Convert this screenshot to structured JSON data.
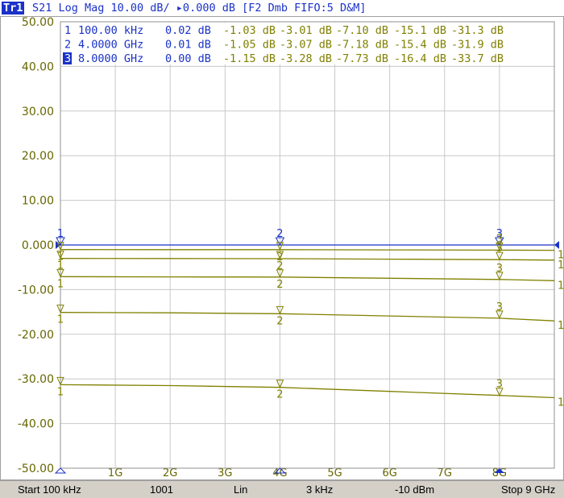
{
  "header": {
    "trace": "Tr1",
    "info": "S21 Log Mag 10.00 dB/ ▸0.000 dB [F2 Dmb FIFO:5 D&M]"
  },
  "footer": {
    "start": "Start 100 kHz",
    "points": "1001",
    "sweep_type": "Lin",
    "ifbw": "3 kHz",
    "power": "-10 dBm",
    "stop": "Stop 9 GHz"
  },
  "colors": {
    "active": "#1a32c8",
    "trace": "#808000",
    "grid": "#c8c8c8",
    "axis_text": "#666600"
  },
  "chart_data": {
    "type": "line",
    "title": "",
    "xlabel": "",
    "ylabel": "",
    "xlim": [
      0.0001,
      9
    ],
    "ylim": [
      -50,
      50
    ],
    "x_unit": "GHz",
    "y_unit": "dB",
    "grid": true,
    "y_ticks": [
      "50.00",
      "40.00",
      "30.00",
      "20.00",
      "10.00",
      "0.000",
      "-10.00",
      "-20.00",
      "-30.00",
      "-40.00",
      "-50.00"
    ],
    "x_ticks": [
      {
        "value": 1,
        "label": "1G"
      },
      {
        "value": 2,
        "label": "2G"
      },
      {
        "value": 3,
        "label": "3G"
      },
      {
        "value": 4,
        "label": "4G"
      },
      {
        "value": 5,
        "label": "5G"
      },
      {
        "value": 6,
        "label": "6G"
      },
      {
        "value": 7,
        "label": "7G"
      },
      {
        "value": 8,
        "label": "8G"
      }
    ],
    "series": [
      {
        "x": [
          0.0001,
          1,
          2,
          3,
          4,
          5,
          6,
          7,
          8,
          9
        ],
        "y": [
          0.0,
          0.0,
          0.0,
          0.0,
          0.0,
          0.0,
          0.0,
          0.0,
          0.0,
          0.0
        ]
      },
      {
        "x": [
          0.0001,
          2,
          4,
          6,
          8,
          9
        ],
        "y": [
          -1.03,
          -1.05,
          -1.05,
          -1.1,
          -1.15,
          -1.2
        ]
      },
      {
        "x": [
          0.0001,
          2,
          4,
          6,
          8,
          9
        ],
        "y": [
          -3.01,
          -3.04,
          -3.07,
          -3.18,
          -3.28,
          -3.4
        ]
      },
      {
        "x": [
          0.0001,
          2,
          4,
          6,
          8,
          9
        ],
        "y": [
          -7.1,
          -7.14,
          -7.18,
          -7.45,
          -7.73,
          -8.0
        ]
      },
      {
        "x": [
          0.0001,
          2,
          4,
          6,
          8,
          9
        ],
        "y": [
          -15.1,
          -15.2,
          -15.4,
          -15.9,
          -16.4,
          -17.0
        ]
      },
      {
        "x": [
          0.0001,
          2,
          4,
          6,
          8,
          9
        ],
        "y": [
          -31.3,
          -31.5,
          -31.9,
          -32.8,
          -33.7,
          -34.2
        ]
      }
    ],
    "markers": [
      {
        "label": "1",
        "freq": "100.00 kHz",
        "x": 0.0001,
        "values": [
          "0.02 dB",
          "-1.03 dB",
          "-3.01 dB",
          "-7.10 dB",
          "-15.1 dB",
          "-31.3 dB"
        ]
      },
      {
        "label": "2",
        "freq": "4.0000 GHz",
        "x": 4,
        "values": [
          "0.01 dB",
          "-1.05 dB",
          "-3.07 dB",
          "-7.18 dB",
          "-15.4 dB",
          "-31.9 dB"
        ]
      },
      {
        "label": "3",
        "freq": "8.0000 GHz",
        "x": 8,
        "values": [
          "0.00 dB",
          "-1.15 dB",
          "-3.28 dB",
          "-7.73 dB",
          "-16.4 dB",
          "-33.7 dB"
        ]
      }
    ],
    "active_marker": "3"
  }
}
